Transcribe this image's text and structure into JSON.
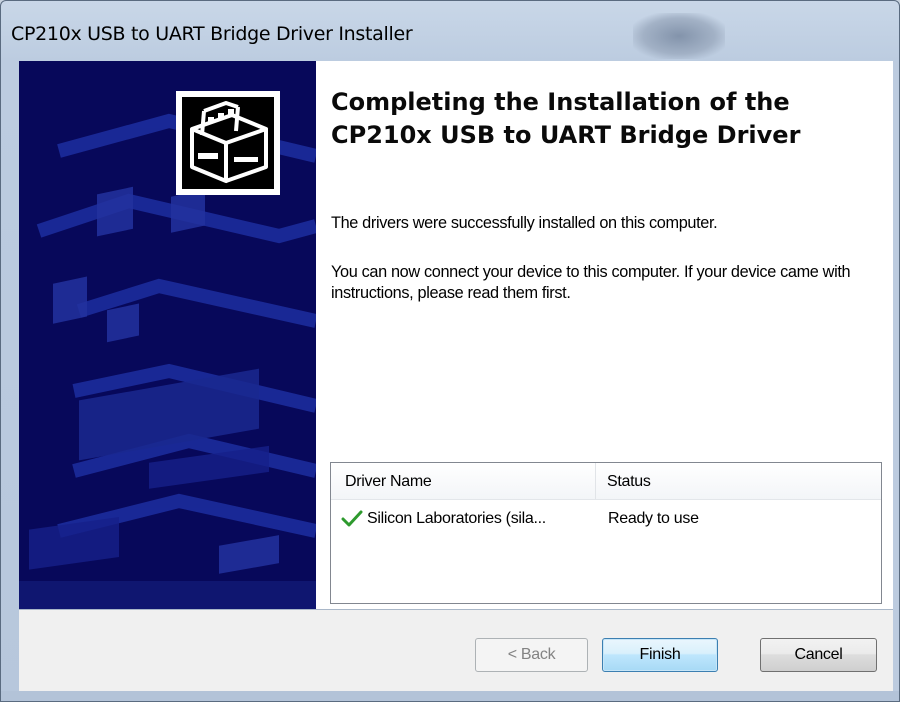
{
  "window": {
    "title": "CP210x USB to UART Bridge Driver Installer"
  },
  "banner": {
    "icon": "setup-package-icon",
    "background_color": "#07085a"
  },
  "main": {
    "heading": "Completing the Installation of the CP210x USB to UART Bridge Driver",
    "success_text": "The drivers were successfully installed on this computer.",
    "instructions_text": "You can now connect your device to this computer. If your device came with instructions, please read them first."
  },
  "driver_list": {
    "columns": [
      "Driver Name",
      "Status"
    ],
    "rows": [
      {
        "icon": "checkmark-icon",
        "name": "Silicon Laboratories (sila...",
        "status": "Ready to use"
      }
    ]
  },
  "buttons": {
    "back": "< Back",
    "finish": "Finish",
    "cancel": "Cancel"
  }
}
